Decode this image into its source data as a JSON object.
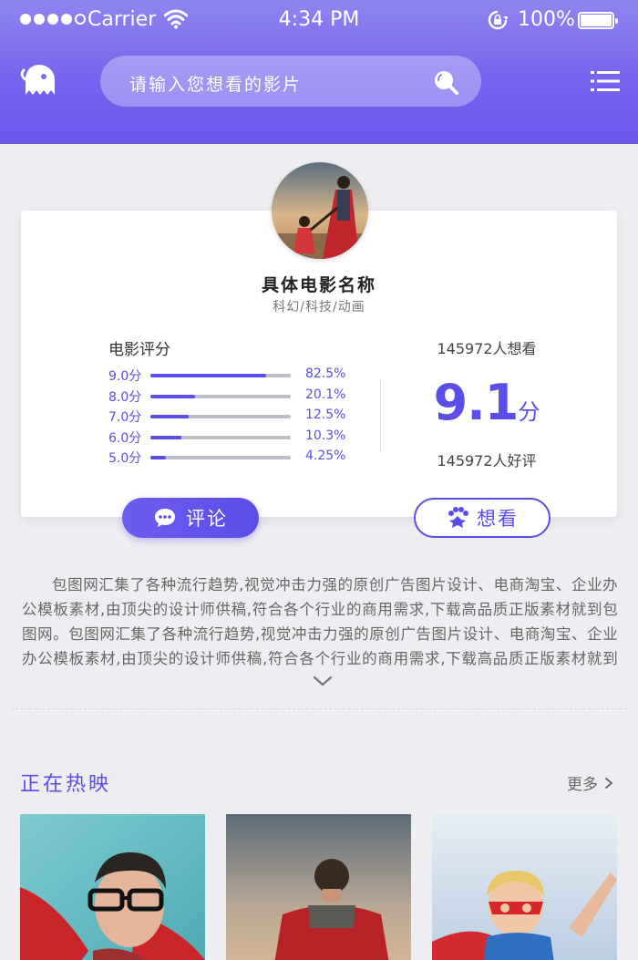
{
  "status_bar": {
    "carrier": "Carrier",
    "time": "4:34 PM",
    "battery": "100%"
  },
  "header": {
    "search_placeholder": "请输入您想看的影片"
  },
  "movie": {
    "title": "具体电影名称",
    "genre": "科幻/科技/动画",
    "rating_label": "电影评分",
    "ratings": [
      {
        "star": "9.0分",
        "fraction": 0.825,
        "percent": "82.5%"
      },
      {
        "star": "8.0分",
        "fraction": 0.32,
        "percent": "20.1%"
      },
      {
        "star": "7.0分",
        "fraction": 0.27,
        "percent": "12.5%"
      },
      {
        "star": "6.0分",
        "fraction": 0.22,
        "percent": "10.3%"
      },
      {
        "star": "5.0分",
        "fraction": 0.11,
        "percent": "4.25%"
      }
    ],
    "want_count": "145972人想看",
    "score": "9.1",
    "score_unit": "分",
    "good_count": "145972人好评",
    "comment_button": "评论",
    "want_button": "想看"
  },
  "description": "包图网汇集了各种流行趋势,视觉冲击力强的原创广告图片设计、电商淘宝、企业办公模板素材,由顶尖的设计师供稿,符合各个行业的商用需求,下载高品质正版素材就到包图网。包图网汇集了各种流行趋势,视觉冲击力强的原创广告图片设计、电商淘宝、企业办公模板素材,由顶尖的设计师供稿,符合各个行业的商用需求,下载高品质正版素材就到包图网。",
  "now_showing": {
    "title": "正在热映",
    "more": "更多"
  },
  "colors": {
    "accent": "#5b4de8",
    "header_top": "#8f86ef",
    "header_bottom": "#6a58ec"
  },
  "icons": [
    "ghost-icon",
    "search-icon",
    "menu-icon",
    "wifi-icon",
    "lock-rotation-icon",
    "chat-icon",
    "paw-icon",
    "chevron-down-icon",
    "chevron-right-icon"
  ]
}
